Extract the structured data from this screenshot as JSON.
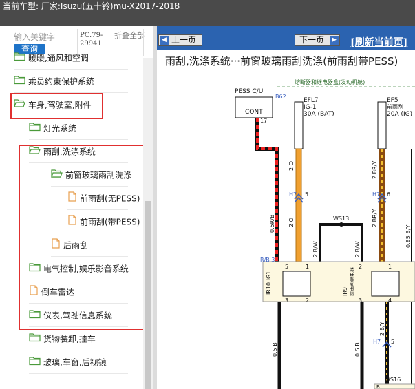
{
  "topbar": {
    "title": "当前车型:  厂家:Isuzu(五十铃)mu-X2017-2018"
  },
  "search": {
    "placeholder": "输入关键字",
    "query_button": "查询",
    "pc_code": "PC.79-29941",
    "collapse_all": "折叠全部"
  },
  "tree": {
    "items": [
      {
        "label": "暖暖,通风和空调",
        "icon": "folder-icon"
      },
      {
        "label": "乘员约束保护系统",
        "icon": "folder-icon"
      },
      {
        "label": "车身,驾驶室,附件",
        "icon": "folder-open-icon"
      },
      {
        "label": "灯光系统",
        "icon": "folder-icon"
      },
      {
        "label": "雨刮,洗涤系统",
        "icon": "folder-open-icon"
      },
      {
        "label": "前窗玻璃雨刮洗涤",
        "icon": "folder-open-icon"
      },
      {
        "label": "前雨刮(无PESS)",
        "icon": "file-icon"
      },
      {
        "label": "前雨刮(带PESS)",
        "icon": "file-icon"
      },
      {
        "label": "后雨刮",
        "icon": "file-icon"
      },
      {
        "label": "电气控制,娱乐影音系统",
        "icon": "folder-icon"
      },
      {
        "label": "倒车雷达",
        "icon": "file-icon"
      },
      {
        "label": "仪表,驾驶信息系统",
        "icon": "folder-icon"
      },
      {
        "label": "货物装卸,挂车",
        "icon": "folder-icon"
      },
      {
        "label": "玻璃,车窗,后视镜",
        "icon": "folder-icon"
      }
    ]
  },
  "viewer": {
    "prev_label": "上一页",
    "next_label": "下一页",
    "refresh_label": "[刷新当前页]",
    "title": "雨刮,洗涤系统···前窗玻璃雨刮洗涤(前雨刮带PESS)"
  },
  "diagram": {
    "fuse_box": "熔断器和继电器盒(发动机舱)",
    "pess": "PESS C/U",
    "cont": "CONT",
    "b62": "B62",
    "pin17": "17",
    "efl7_name": "EFL7",
    "efl7_sub": "IG-1",
    "efl7_rating": "30A (BAT)",
    "ef5_name": "EF5",
    "ef5_sub": "前雨刮",
    "ef5_rating": "20A (IG)",
    "h7": "H7",
    "pin5": "5",
    "pin6": "6",
    "w_2o": "2 O",
    "w_2bry": "2 BR/Y",
    "w_05rb": "0.5R/B",
    "w_085by": "0.85 B/Y",
    "ws13": "WS13",
    "w_2bw": "2 B/W",
    "rb3": "R/B 3",
    "ir10": "IR10 IG1",
    "ir9": "IR9",
    "ir9_sub": "前雨刮继电器",
    "pin1": "1",
    "pin2": "2",
    "pin3": "3",
    "pin4": "4",
    "w_05b": "0.5 B",
    "w_2by": "2 B/Y",
    "ws16": "WS16",
    "pinB": "B",
    "h7b": "H7",
    "pin5b": "5"
  }
}
